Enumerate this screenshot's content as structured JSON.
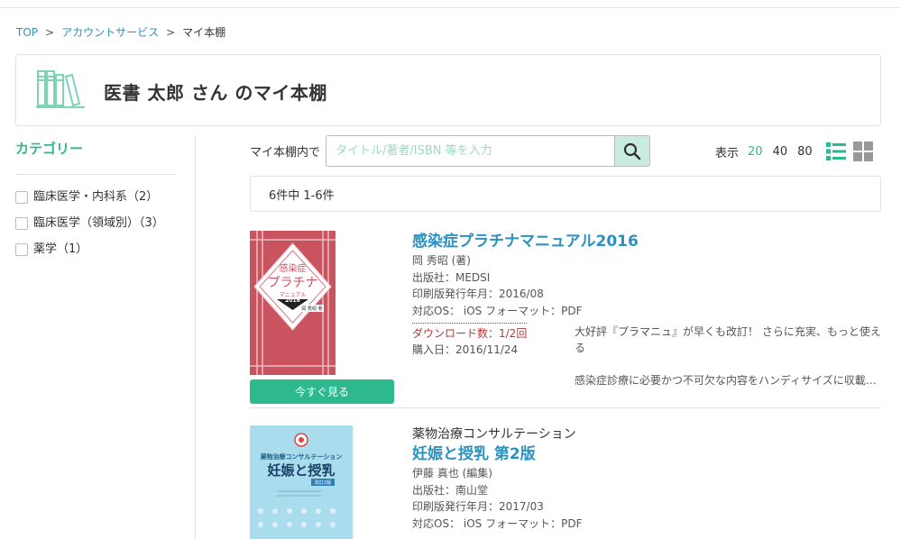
{
  "breadcrumb": {
    "top": "TOP",
    "account": "アカウントサービス",
    "current": "マイ本棚",
    "separator": ">"
  },
  "header": {
    "title": "医書 太郎 さん のマイ本棚",
    "icon": "bookshelf-icon"
  },
  "sidebar": {
    "title": "カテゴリー",
    "categories": [
      {
        "label": "臨床医学・内科系（2）"
      },
      {
        "label": "臨床医学（領域別）（3）"
      },
      {
        "label": "薬学（1）"
      }
    ]
  },
  "search": {
    "label": "マイ本棚内で",
    "placeholder": "タイトル/著者/ISBN 等を入力",
    "value": ""
  },
  "display": {
    "label": "表示",
    "options": [
      "20",
      "40",
      "80"
    ],
    "selected": "20"
  },
  "results": {
    "count_text": "6件中 1-6件"
  },
  "books": [
    {
      "series": "",
      "title": "感染症プラチナマニュアル2016",
      "author": "岡 秀昭 (著)",
      "publisher": "出版社：MEDSI",
      "print_date": "印刷版発行年月：2016/08",
      "os": "対応OS： iOS フォーマット：PDF",
      "downloads": "ダウンロード数：1/2回",
      "purchase": "購入日：2016/11/24",
      "desc1": "大好評『プラマニュ』が早くも改訂！ さらに充実、もっと使える",
      "desc2": "感染症診療に必要かつ不可欠な内容をハンディサイズに収載…",
      "read_label": "今すぐ見る",
      "cover": {
        "top": "感染症",
        "main": "プラチナ",
        "sub": "マニュアル",
        "year": "2016",
        "author": "岡 秀昭 著"
      }
    },
    {
      "series": "薬物治療コンサルテーション",
      "title": "妊娠と授乳 第2版",
      "author": "伊藤 真也 (編集)",
      "publisher": "出版社：南山堂",
      "print_date": "印刷版発行年月：2017/03",
      "os": "対応OS： iOS フォーマット：PDF",
      "cover": {
        "series": "薬物治療コンサルテーション",
        "main": "妊娠と授乳",
        "edition": "改訂2版"
      }
    }
  ],
  "colors": {
    "accent_green": "#36b58a",
    "button_green": "#2eb88e",
    "link_blue": "#2b91bf",
    "download_red": "#b03a3a",
    "cover1_bg": "#c9535f",
    "cover2_bg": "#a9dcec"
  }
}
